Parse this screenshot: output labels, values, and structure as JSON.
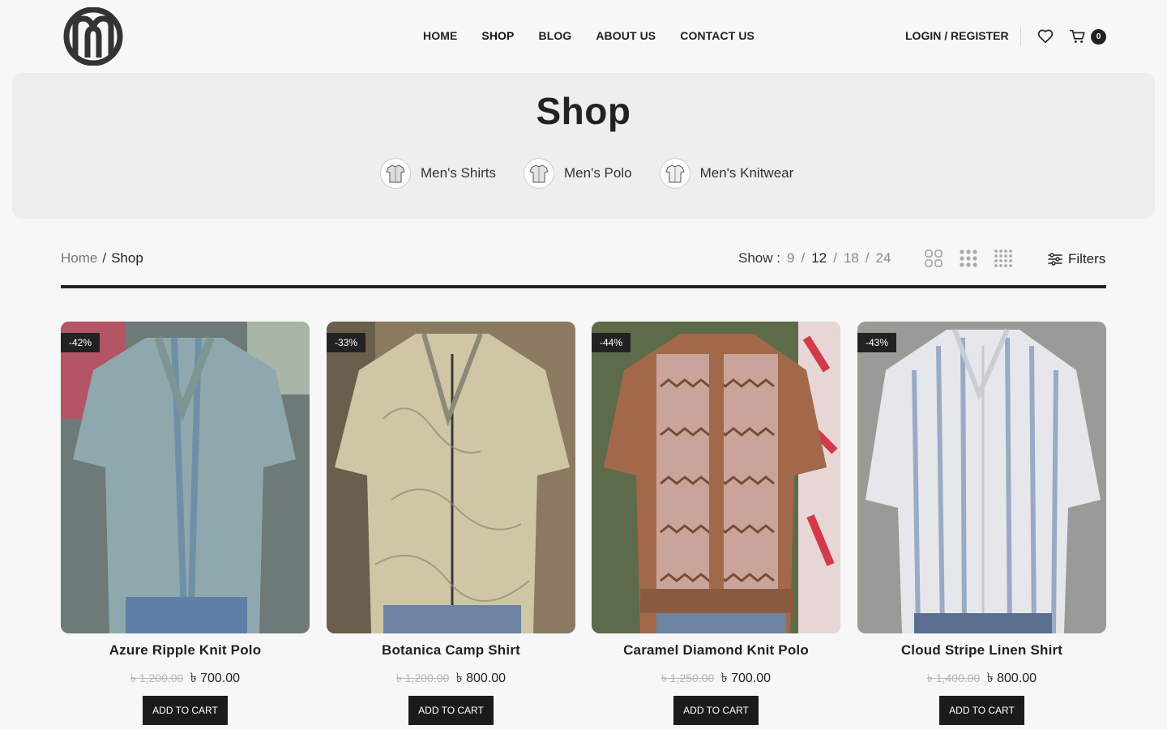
{
  "header": {
    "nav": [
      "HOME",
      "SHOP",
      "BLOG",
      "ABOUT US",
      "CONTACT US"
    ],
    "login_label": "LOGIN / REGISTER",
    "cart_count": "0"
  },
  "hero": {
    "title": "Shop",
    "categories": [
      {
        "label": "Men's Shirts"
      },
      {
        "label": "Men's Polo"
      },
      {
        "label": "Men's Knitwear"
      }
    ]
  },
  "toolbar": {
    "breadcrumb": {
      "home": "Home",
      "separator": "/",
      "current": "Shop"
    },
    "show_label": "Show :",
    "show_options": [
      "9",
      "12",
      "18",
      "24"
    ],
    "show_selected": "12",
    "filters_label": "Filters"
  },
  "products": [
    {
      "name": "Azure Ripple Knit Polo",
      "badge": "-42%",
      "old_price": "৳ 1,200.00",
      "price": "৳ 700.00",
      "button": "ADD TO CART",
      "colors": [
        "#8fa8ae",
        "#6f8fa7"
      ]
    },
    {
      "name": "Botanica Camp Shirt",
      "badge": "-33%",
      "old_price": "৳ 1,200.00",
      "price": "৳ 800.00",
      "button": "ADD TO CART",
      "colors": [
        "#cfc6a6",
        "#8b8a78"
      ]
    },
    {
      "name": "Caramel Diamond Knit Polo",
      "badge": "-44%",
      "old_price": "৳ 1,250.00",
      "price": "৳ 700.00",
      "button": "ADD TO CART",
      "colors": [
        "#a2684a",
        "#7a4a35"
      ]
    },
    {
      "name": "Cloud Stripe Linen Shirt",
      "badge": "-43%",
      "old_price": "৳ 1,400.00",
      "price": "৳ 800.00",
      "button": "ADD TO CART",
      "colors": [
        "#e6e7ea",
        "#9aaac4"
      ]
    }
  ],
  "colors": {
    "accent": "#222222",
    "hero_bg": "#eeeeee",
    "page_bg": "#f7f7f7"
  }
}
